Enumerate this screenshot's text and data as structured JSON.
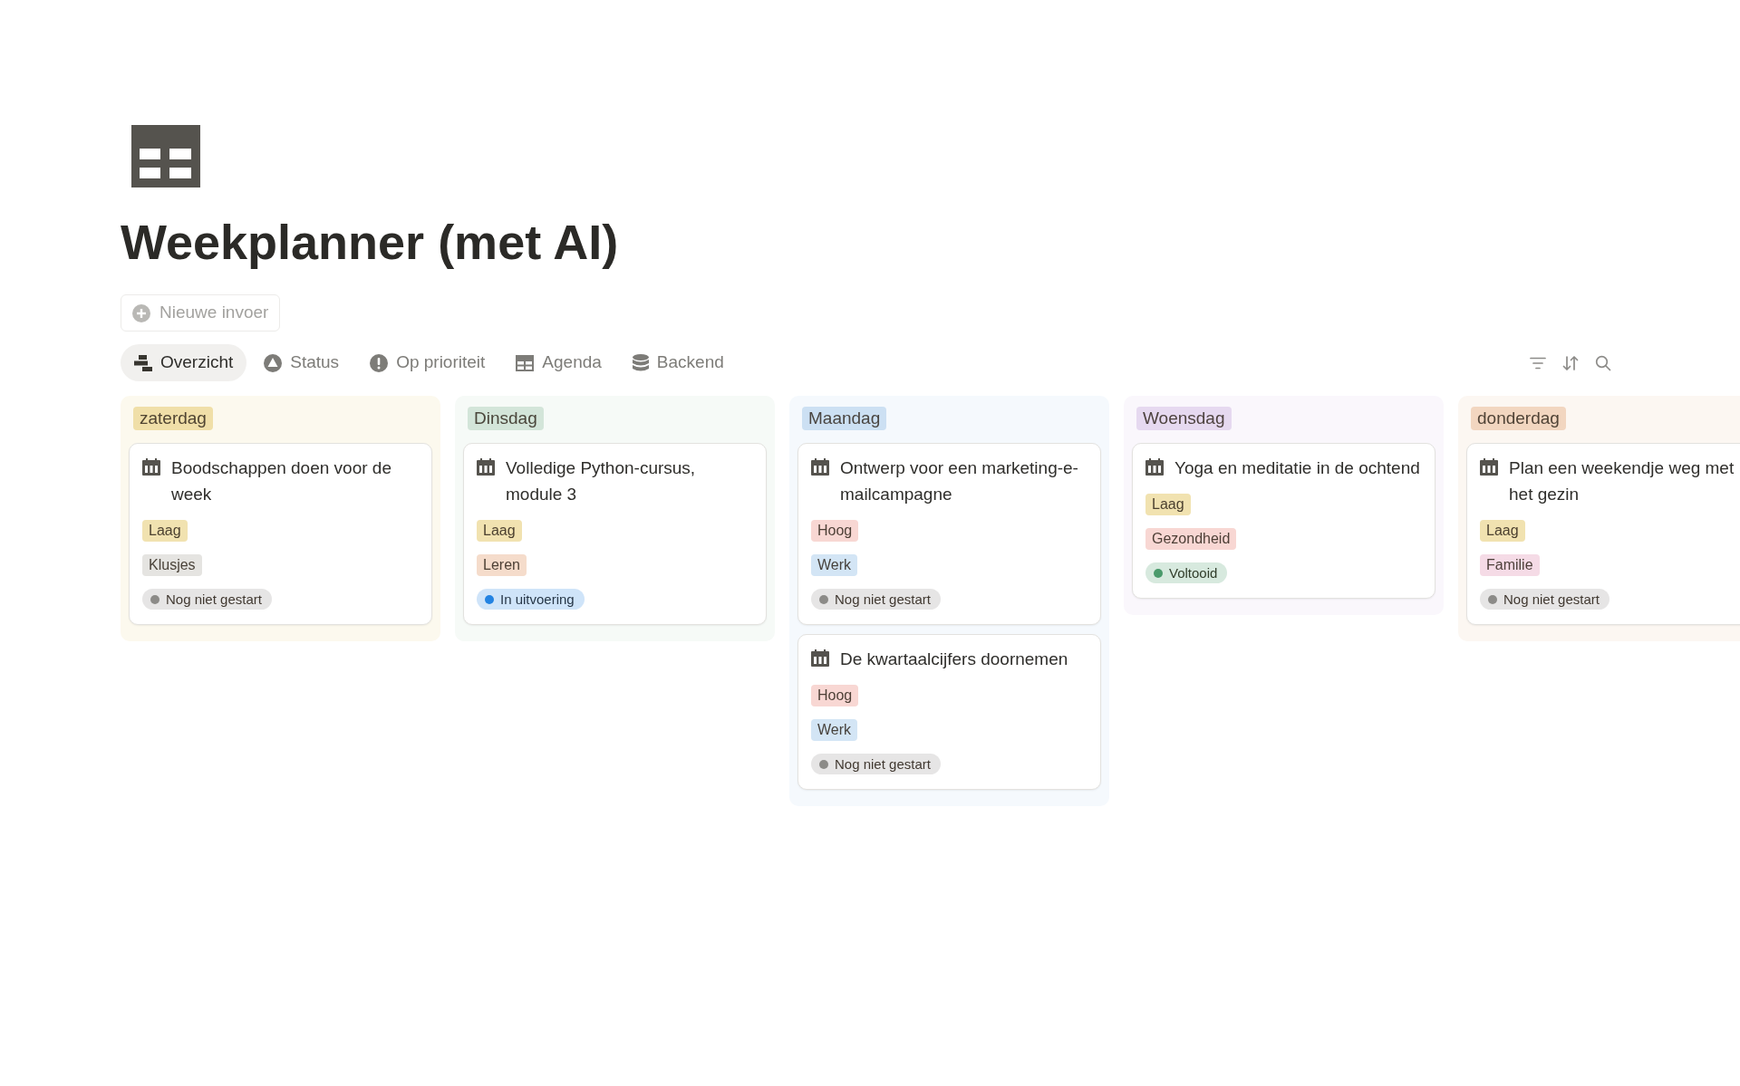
{
  "page": {
    "title": "Weekplanner (met AI)"
  },
  "new_entry": {
    "label": "Nieuwe invoer"
  },
  "tabs": [
    {
      "label": "Overzicht",
      "selected": true
    },
    {
      "label": "Status",
      "selected": false
    },
    {
      "label": "Op prioriteit",
      "selected": false
    },
    {
      "label": "Agenda",
      "selected": false
    },
    {
      "label": "Backend",
      "selected": false
    }
  ],
  "columns": [
    {
      "label": "zaterdag",
      "color": "#f0dfa8",
      "cards": [
        {
          "title": "Boodschappen doen voor de week",
          "priority": {
            "label": "Laag",
            "color": "#f1e2b0"
          },
          "category": {
            "label": "Klusjes",
            "color": "#e5e4e1"
          },
          "status": {
            "label": "Nog niet gestart",
            "color": "#8c8b88"
          }
        }
      ]
    },
    {
      "label": "Dinsdag",
      "color": "#d3e5d9",
      "cards": [
        {
          "title": "Volledige Python-cursus, module 3",
          "priority": {
            "label": "Laag",
            "color": "#f1e2b0"
          },
          "category": {
            "label": "Leren",
            "color": "#f5dccb"
          },
          "status": {
            "label": "In uitvoering",
            "color": "#2383e2"
          }
        }
      ]
    },
    {
      "label": "Maandag",
      "color": "#cce0f3",
      "cards": [
        {
          "title": "Ontwerp voor een marketing-e-mailcampagne",
          "priority": {
            "label": "Hoog",
            "color": "#f8d7d3"
          },
          "category": {
            "label": "Werk",
            "color": "#d3e5f5"
          },
          "status": {
            "label": "Nog niet gestart",
            "color": "#8c8b88"
          }
        },
        {
          "title": "De kwartaalcijfers doornemen",
          "priority": {
            "label": "Hoog",
            "color": "#f8d7d3"
          },
          "category": {
            "label": "Werk",
            "color": "#d3e5f5"
          },
          "status": {
            "label": "Nog niet gestart",
            "color": "#8c8b88"
          }
        }
      ]
    },
    {
      "label": "Woensdag",
      "color": "#e6d9f0",
      "cards": [
        {
          "title": "Yoga en meditatie in de ochtend",
          "priority": {
            "label": "Laag",
            "color": "#f1e2b0"
          },
          "category": {
            "label": "Gezondheid",
            "color": "#f8d7d3"
          },
          "status": {
            "label": "Voltooid",
            "color": "#4a9a6b"
          }
        }
      ]
    },
    {
      "label": "donderdag",
      "color": "#f2d6c0",
      "cards": [
        {
          "title": "Plan een weekendje weg met het gezin",
          "priority": {
            "label": "Laag",
            "color": "#f1e2b0"
          },
          "category": {
            "label": "Familie",
            "color": "#f5dbe6"
          },
          "status": {
            "label": "Nog niet gestart",
            "color": "#8c8b88"
          }
        }
      ]
    }
  ]
}
